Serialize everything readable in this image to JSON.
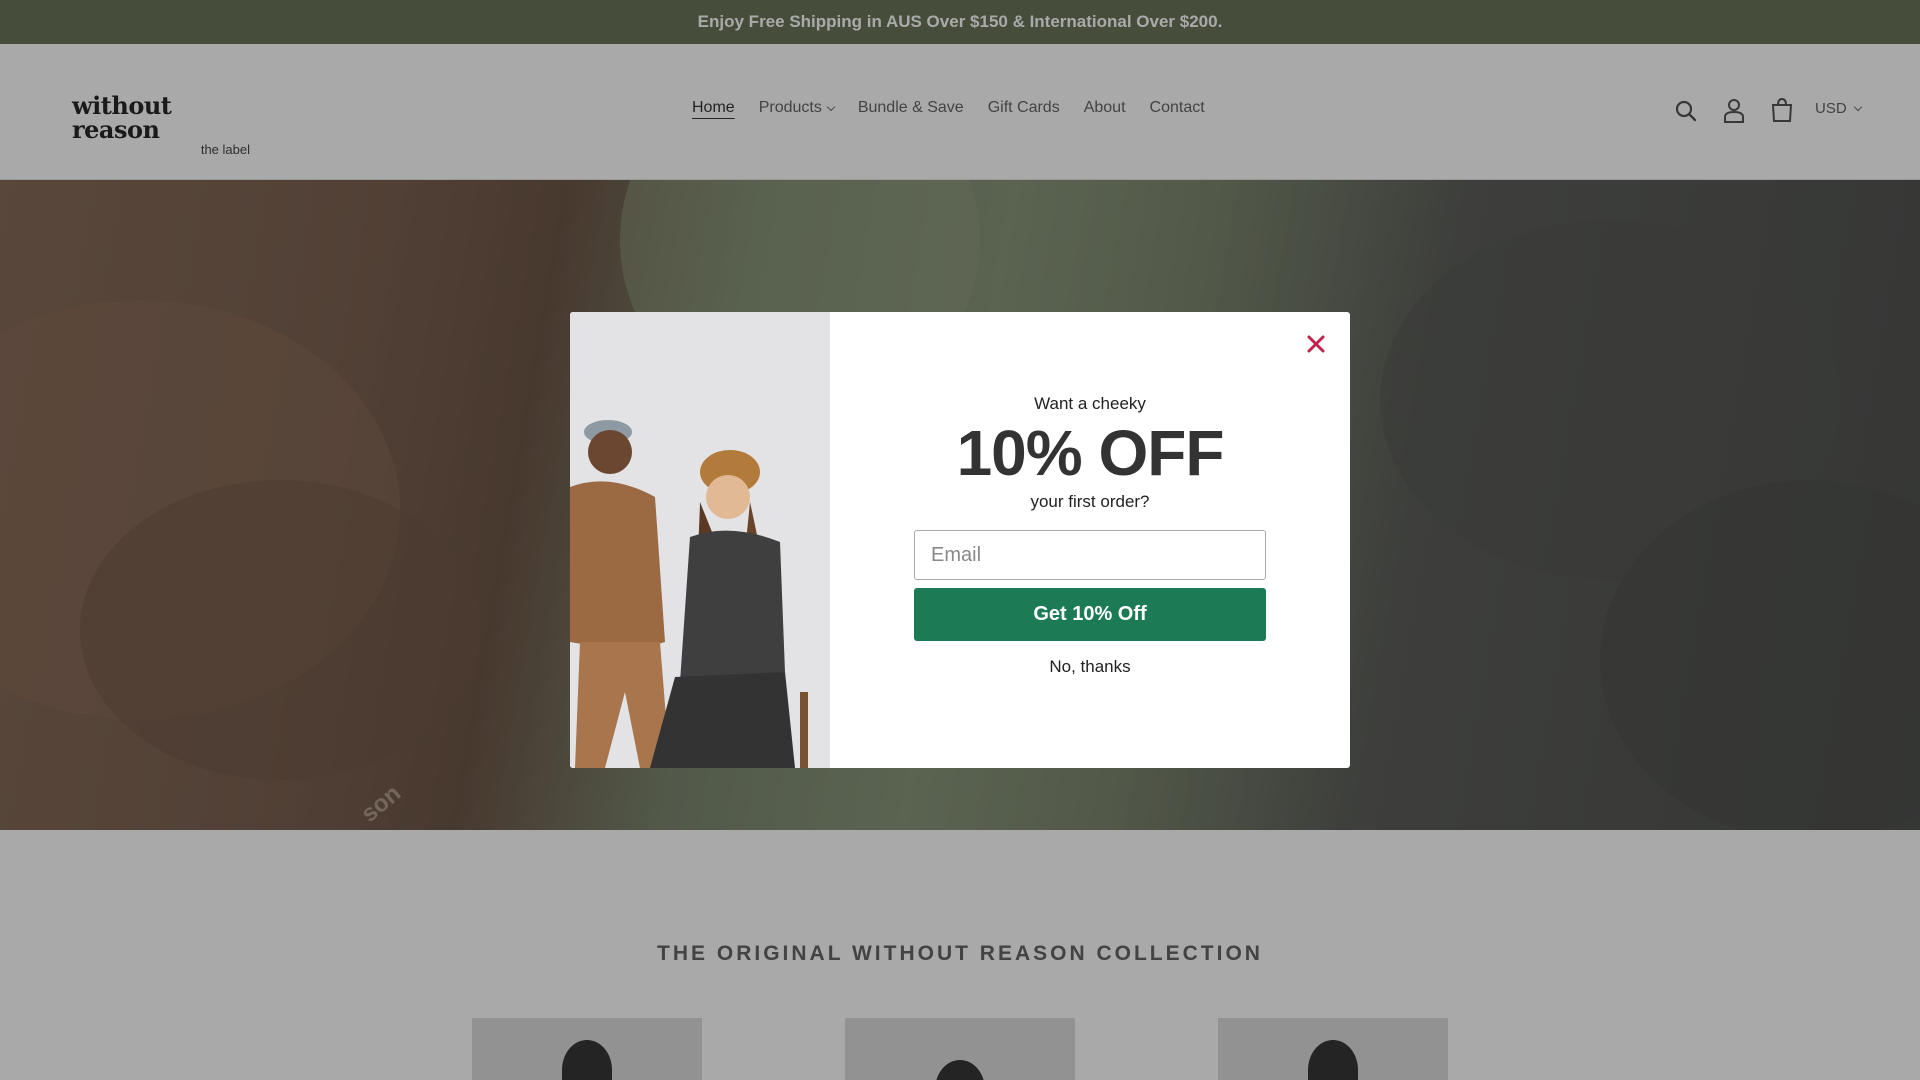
{
  "announcement": {
    "text": "Enjoy Free Shipping in AUS Over $150 & International Over $200."
  },
  "header": {
    "logo_main": "without reason",
    "logo_sub": "the label",
    "nav": [
      {
        "label": "Home",
        "active": true
      },
      {
        "label": "Products",
        "dropdown": true
      },
      {
        "label": "Bundle & Save"
      },
      {
        "label": "Gift Cards"
      },
      {
        "label": "About"
      },
      {
        "label": "Contact"
      }
    ],
    "icons": [
      "search-icon",
      "account-icon",
      "cart-icon"
    ],
    "currency": "USD"
  },
  "hero": {
    "watermark": "son"
  },
  "collection": {
    "title": "THE ORIGINAL WITHOUT REASON COLLECTION"
  },
  "popup": {
    "pre_text": "Want a cheeky",
    "headline": "10% OFF",
    "post_text": "your first order?",
    "email_placeholder": "Email",
    "cta_label": "Get 10% Off",
    "decline_label": "No, thanks"
  },
  "colors": {
    "announcement_bg": "#5b6749",
    "cta_bg": "#1c7a55",
    "close_icon": "#c0254f"
  }
}
